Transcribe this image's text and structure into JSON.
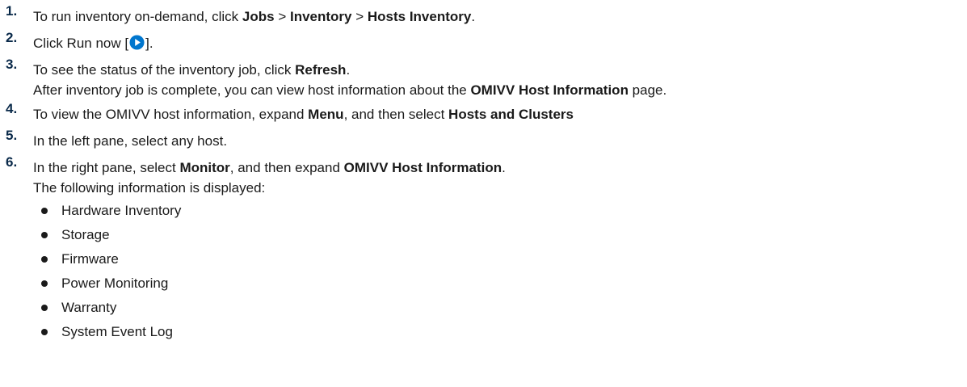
{
  "steps": [
    {
      "number": "1.",
      "segments": [
        "To run inventory on-demand, click ",
        "Jobs",
        " > ",
        "Inventory",
        " > ",
        "Hosts Inventory",
        "."
      ]
    },
    {
      "number": "2.",
      "prefix": "Click Run now [",
      "suffix": "].",
      "icon": "run-now-icon",
      "icon_color": "#0076ce"
    },
    {
      "number": "3.",
      "segments": [
        "To see the status of the inventory job, click ",
        "Refresh",
        "."
      ],
      "note_segments": [
        "After inventory job is complete, you can view host information about the ",
        "OMIVV Host Information",
        " page."
      ]
    },
    {
      "number": "4.",
      "segments": [
        "To view the OMIVV host information, expand ",
        "Menu",
        ", and then select ",
        "Hosts and Clusters"
      ]
    },
    {
      "number": "5.",
      "text": "In the left pane, select any host."
    },
    {
      "number": "6.",
      "segments": [
        "In the right pane, select ",
        "Monitor",
        ", and then expand ",
        "OMIVV Host Information",
        "."
      ],
      "note": "The following information is displayed:",
      "bullets": [
        "Hardware Inventory",
        "Storage",
        "Firmware",
        "Power Monitoring",
        "Warranty",
        "System Event Log"
      ]
    }
  ]
}
